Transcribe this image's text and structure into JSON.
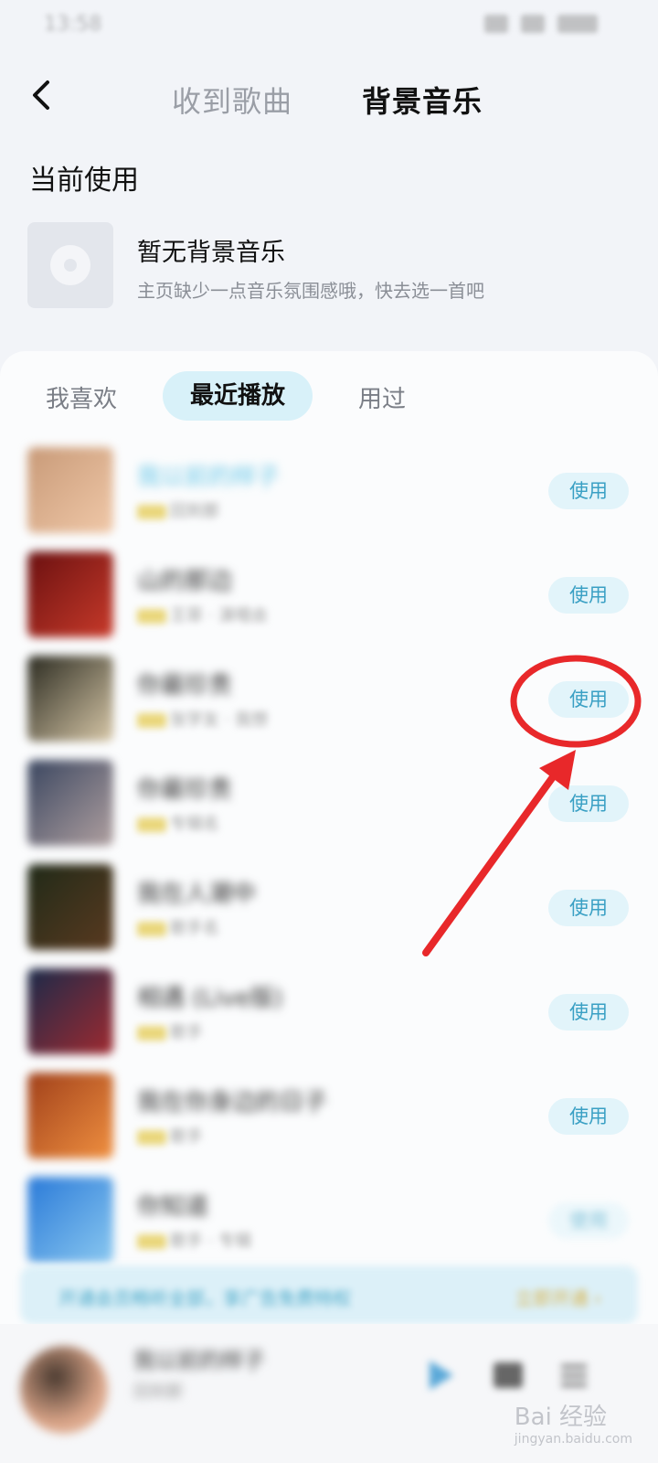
{
  "status_bar": {
    "time": "13:58"
  },
  "header": {
    "tabs": [
      {
        "label": "收到歌曲",
        "active": false
      },
      {
        "label": "背景音乐",
        "active": true
      }
    ]
  },
  "current": {
    "section_title": "当前使用",
    "name": "暂无背景音乐",
    "description": "主页缺少一点音乐氛围感哦，快去选一首吧"
  },
  "filters": [
    {
      "label": "我喜欢",
      "active": false
    },
    {
      "label": "最近播放",
      "active": true
    },
    {
      "label": "用过",
      "active": false
    }
  ],
  "songs": [
    {
      "title": "我以前的样子",
      "meta": "回到那",
      "use_label": "使用",
      "cover_colors": [
        "#c89a78",
        "#f0c8a8"
      ]
    },
    {
      "title": "山的那边",
      "meta": "王菲 · 演唱会",
      "use_label": "使用",
      "cover_colors": [
        "#6a1010",
        "#c83a2a"
      ]
    },
    {
      "title": "你最珍贵",
      "meta": "张学友 · 我想",
      "use_label": "使用",
      "cover_colors": [
        "#2a2a20",
        "#d8c8a8"
      ]
    },
    {
      "title": "你最珍贵",
      "meta": "专辑名",
      "use_label": "使用",
      "cover_colors": [
        "#3a4660",
        "#b0a0a0"
      ]
    },
    {
      "title": "我在人潮中",
      "meta": "歌手名",
      "use_label": "使用",
      "cover_colors": [
        "#202a18",
        "#5a3a20"
      ]
    },
    {
      "title": "相遇 (Live版)",
      "meta": "歌手",
      "use_label": "使用",
      "cover_colors": [
        "#1a2a4a",
        "#a02a30"
      ]
    },
    {
      "title": "我在你身边的日子",
      "meta": "歌手",
      "use_label": "使用",
      "cover_colors": [
        "#a0401a",
        "#f09040"
      ]
    },
    {
      "title": "你知道",
      "meta": "歌手 · 专辑",
      "use_label": "使用",
      "cover_colors": [
        "#2a7ad8",
        "#8ac8f0"
      ]
    }
  ],
  "promo": {
    "text": "开通会员畅听全部，享广告免费特权",
    "link": "立即开通 ›"
  },
  "now_playing": {
    "title": "我以前的样子",
    "artist": "回到那"
  },
  "watermark": {
    "brand": "Bai 经验",
    "sub": "jingyan.baidu.com"
  },
  "colors": {
    "accent": "#3aa0c4",
    "button_bg": "#e2f4fa",
    "annotation": "#e8282a"
  },
  "icons": {
    "back": "chevron-left-icon",
    "disc": "disc-icon",
    "play": "play-icon",
    "playlist": "playlist-icon",
    "menu": "menu-icon"
  }
}
